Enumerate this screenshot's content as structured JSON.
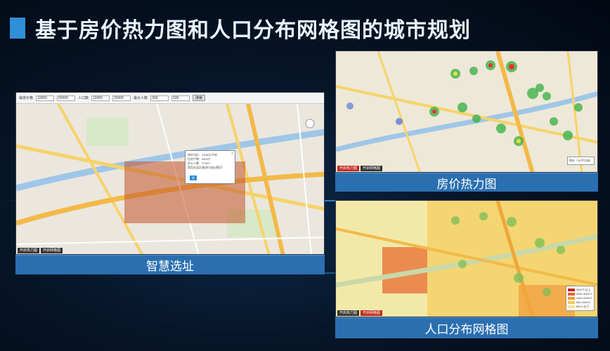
{
  "title": "基于房价热力图和人口分布网格图的城市规划",
  "accent_color": "#2f8fd8",
  "panels": {
    "site": {
      "caption": "智慧选址",
      "toolbar": {
        "labels": [
          "最低价格",
          "最高价格",
          "人口数",
          "最大人数"
        ],
        "values": [
          "10000",
          "50000",
          "10000",
          "30000",
          "300",
          "500"
        ],
        "button": "搜索"
      },
      "popup": {
        "lines": [
          "房价均价：2338元/平米",
          "住宅户数：9603户",
          "办公人数：2796人"
        ],
        "question": "是否在此区域进行选址建设？",
        "ok": "是"
      },
      "status": [
        "开启热力图",
        "开启网格图"
      ]
    },
    "heat": {
      "caption": "房价热力图",
      "legend_title": "房价（元/平方米）",
      "status": [
        "开启热力图",
        "开启网格图"
      ]
    },
    "grid": {
      "caption": "人口分布网格图",
      "legend": [
        "3000人以上",
        "2000-3000人",
        "1000-2000人",
        "500-1000人",
        "500人以下"
      ],
      "legend_colors": [
        "#c0281e",
        "#e8622a",
        "#f29a3c",
        "#f7c95a",
        "#f9e58a"
      ],
      "status": [
        "开启热力图",
        "开启网格图"
      ]
    }
  },
  "icons": {
    "zoom": "zoom-control-icon",
    "close": "close-icon"
  }
}
